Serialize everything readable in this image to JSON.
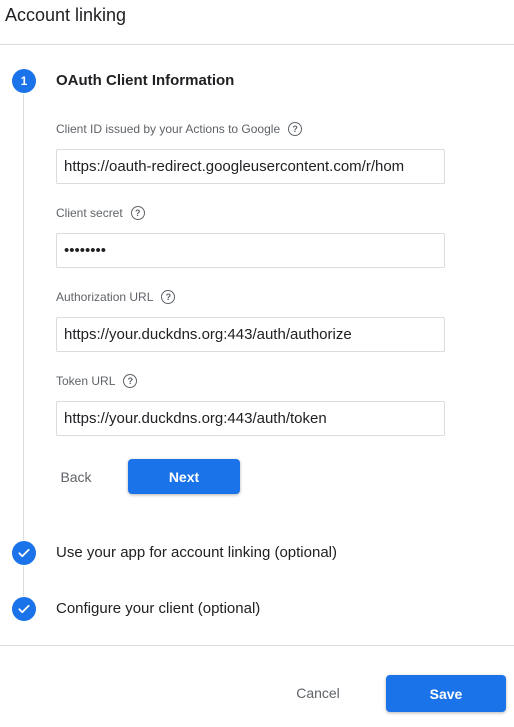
{
  "header": {
    "title": "Account linking"
  },
  "steps": [
    {
      "number": "1",
      "title": "OAuth Client Information"
    },
    {
      "title": "Use your app for account linking (optional)"
    },
    {
      "title": "Configure your client (optional)"
    }
  ],
  "form": {
    "client_id": {
      "label": "Client ID issued by your Actions to Google",
      "value": "https://oauth-redirect.googleusercontent.com/r/hom"
    },
    "client_secret": {
      "label": "Client secret",
      "value": "••••••••"
    },
    "auth_url": {
      "label": "Authorization URL",
      "value": "https://your.duckdns.org:443/auth/authorize"
    },
    "token_url": {
      "label": "Token URL",
      "value": "https://your.duckdns.org:443/auth/token"
    },
    "help_glyph": "?"
  },
  "buttons": {
    "back": "Back",
    "next": "Next",
    "cancel": "Cancel",
    "save": "Save"
  },
  "colors": {
    "accent": "#1a73e8",
    "border": "#dadce0",
    "muted": "#5f6368"
  }
}
